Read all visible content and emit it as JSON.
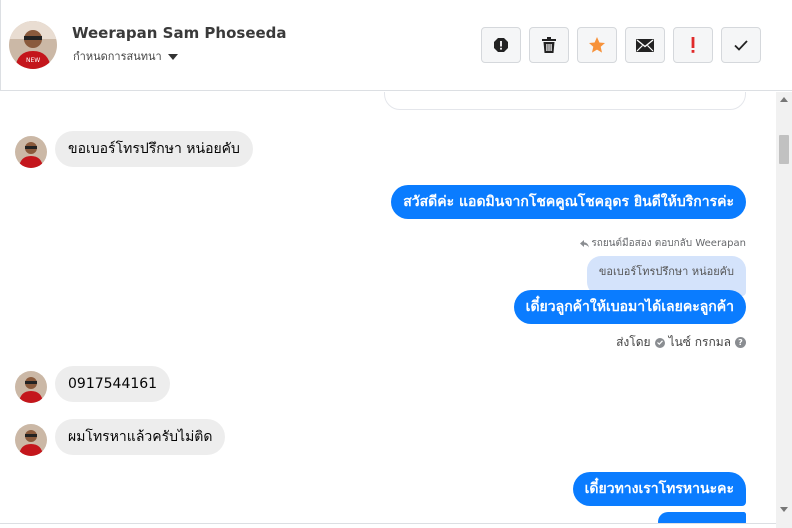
{
  "header": {
    "contact_name": "Weerapan Sam Phoseeda",
    "assign_label": "กำหนดการสนทนา",
    "toolbar": [
      {
        "name": "spam-icon",
        "label": "!"
      },
      {
        "name": "trash-icon",
        "label": ""
      },
      {
        "name": "star-icon",
        "label": ""
      },
      {
        "name": "envelope-icon",
        "label": ""
      },
      {
        "name": "important-icon",
        "label": "!"
      },
      {
        "name": "check-icon",
        "label": ""
      }
    ]
  },
  "messages": {
    "m1": "ขอเบอร์โทรปรึกษา หน่อยคับ",
    "m2": "สวัสดีค่ะ แอดมินจากโชคคูณโชคอุดร ยินดีให้บริการค่ะ",
    "reply_meta": "รถยนต์มือสอง ตอบกลับ Weerapan",
    "quoted": "ขอเบอร์โทรปรึกษา หน่อยคับ",
    "m3": "เดี๋ยวลูกค้าให้เบอมาได้เลยคะลูกค้า",
    "sent_by_prefix": "ส่งโดย",
    "sent_by_name": "ไนซ์ กรกมล",
    "m4": "0917544161",
    "m5": "ผมโทรหาแล้วครับไม่ติด",
    "m6": "เดี๋ยวทางเราโทรหานะคะ"
  },
  "colors": {
    "outgoing": "#0a7cff",
    "incoming": "#ededed",
    "star": "#f7923a",
    "important": "#e02a2a"
  }
}
